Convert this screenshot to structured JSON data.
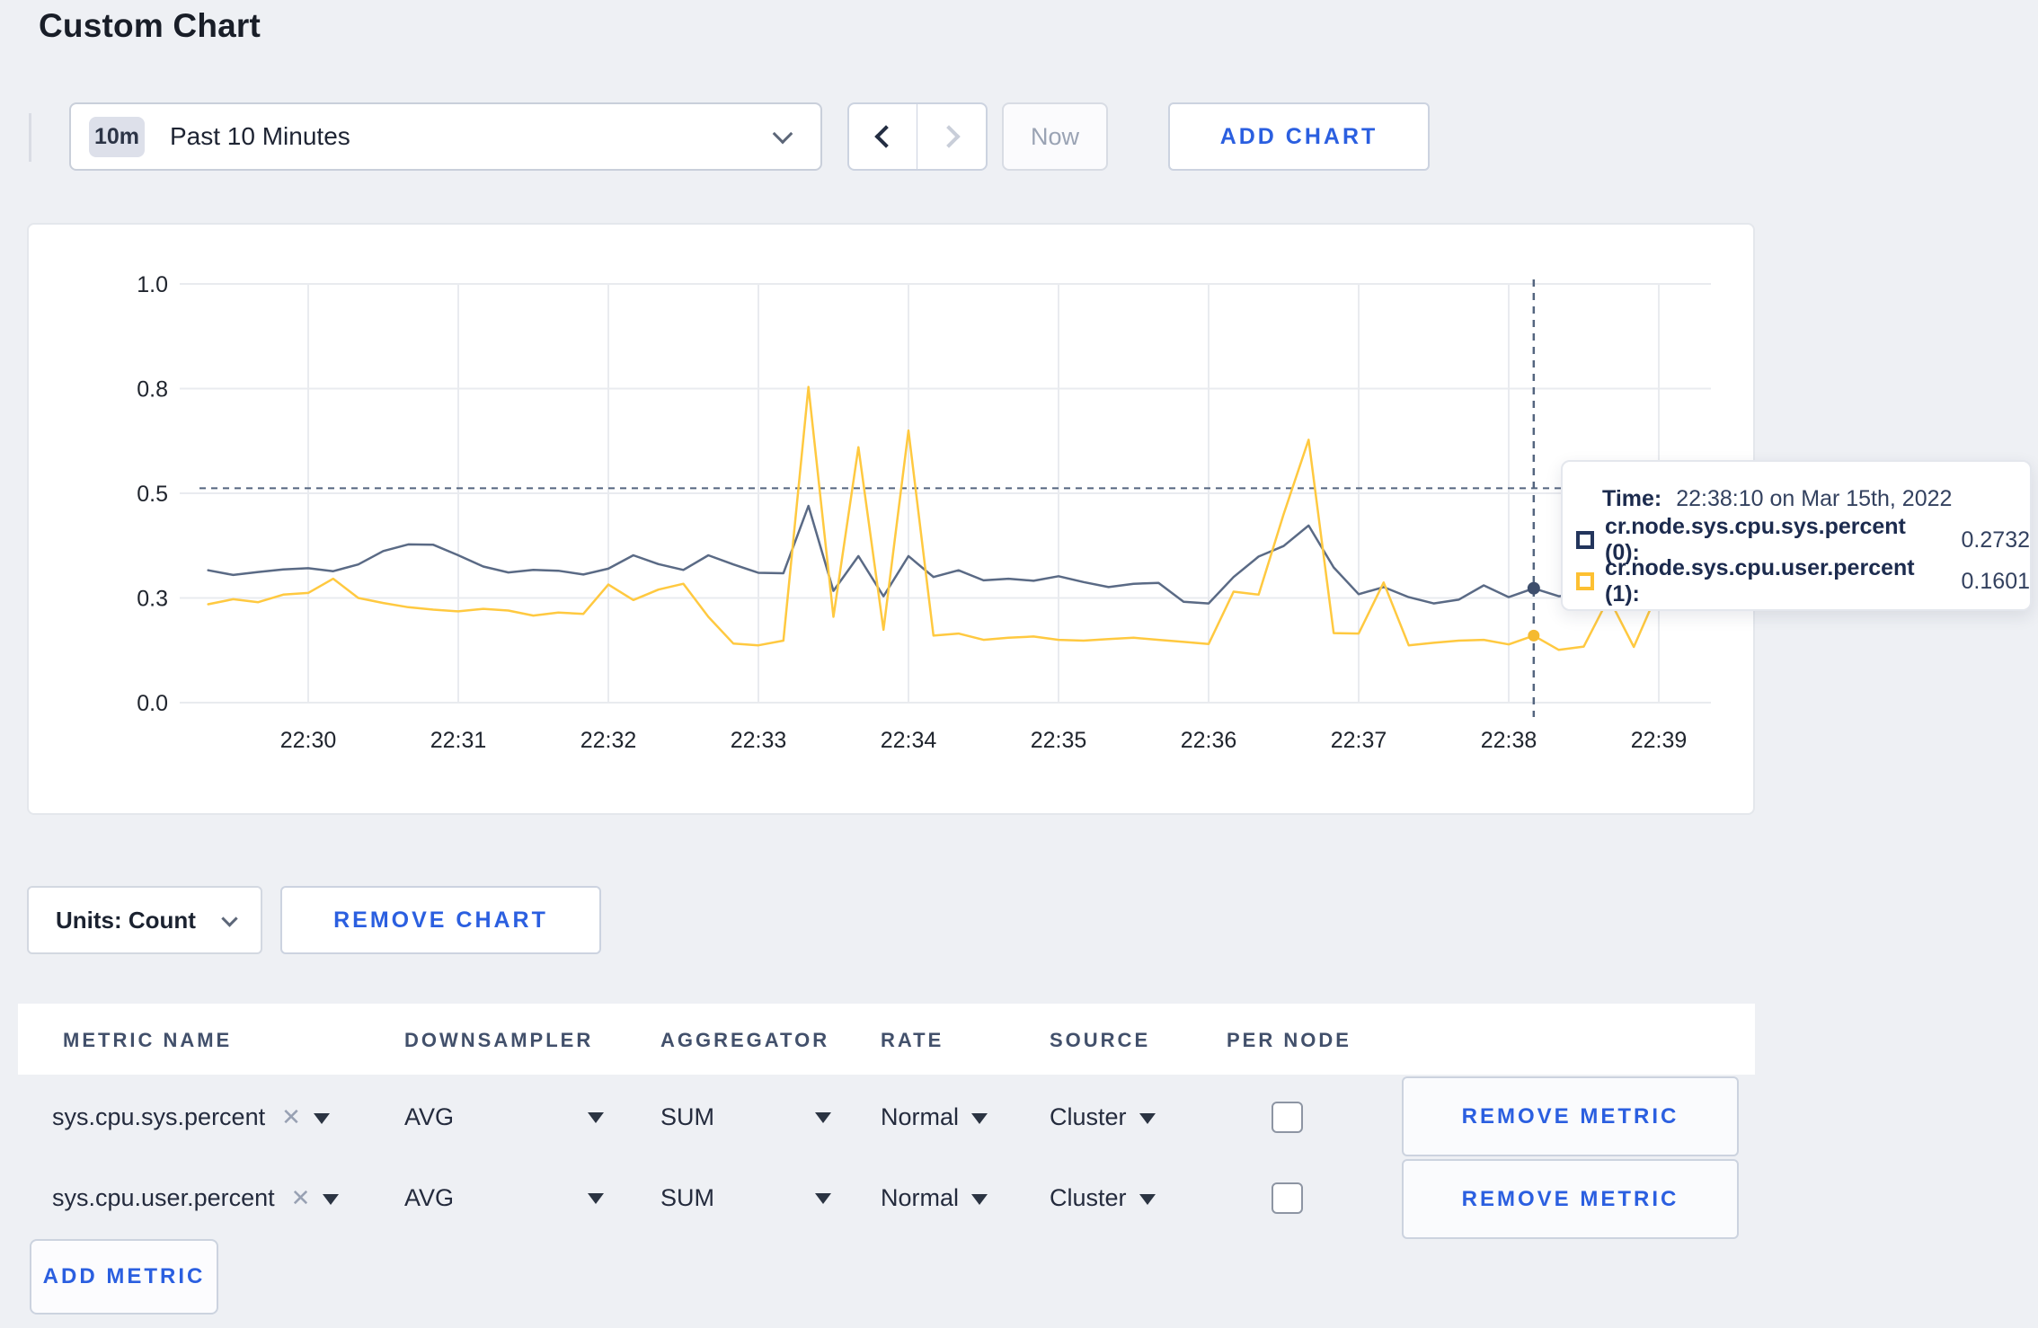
{
  "page": {
    "title": "Custom Chart"
  },
  "toolbar": {
    "time_window_badge": "10m",
    "time_window_label": "Past 10 Minutes",
    "now_label": "Now",
    "add_chart_label": "ADD CHART"
  },
  "chart_data": {
    "type": "line",
    "title": "",
    "xlabel": "",
    "ylabel": "",
    "ylim": [
      0,
      1
    ],
    "grid": true,
    "x_tick_labels": [
      "22:30",
      "22:31",
      "22:32",
      "22:33",
      "22:34",
      "22:35",
      "22:36",
      "22:37",
      "22:38",
      "22:39"
    ],
    "y_ticks": [
      {
        "value": 0,
        "label": "0.0"
      },
      {
        "value": 0.25,
        "label": "0.3"
      },
      {
        "value": 0.5,
        "label": "0.5"
      },
      {
        "value": 0.75,
        "label": "0.8"
      },
      {
        "value": 1.0,
        "label": "1.0"
      }
    ],
    "x_start_time": "22:29:20",
    "x_end_time": "22:39:00",
    "step_seconds": 10,
    "threshold_value": 0.512,
    "threshold_color": "#54657f",
    "grid_color": "#e9ebef",
    "tick_text_color": "#20252e",
    "crosshair": {
      "time": "22:38:10",
      "sys_value": 0.2732,
      "user_value": 0.1601,
      "line_color": "#54657f",
      "sys_dot_color": "#3d4e6c",
      "user_dot_color": "#f5ba30"
    },
    "series": [
      {
        "name": "cr.node.sys.cpu.sys.percent",
        "color": "#5a6a85",
        "values": [
          0.316,
          0.305,
          0.312,
          0.318,
          0.321,
          0.314,
          0.33,
          0.362,
          0.378,
          0.377,
          0.352,
          0.325,
          0.311,
          0.317,
          0.315,
          0.306,
          0.32,
          0.352,
          0.331,
          0.317,
          0.352,
          0.33,
          0.31,
          0.309,
          0.47,
          0.267,
          0.35,
          0.254,
          0.35,
          0.3,
          0.316,
          0.292,
          0.296,
          0.291,
          0.302,
          0.288,
          0.276,
          0.284,
          0.286,
          0.241,
          0.237,
          0.3,
          0.349,
          0.374,
          0.423,
          0.323,
          0.259,
          0.276,
          0.252,
          0.237,
          0.246,
          0.28,
          0.252,
          0.273,
          0.254,
          0.261,
          0.27,
          0.278,
          0.296
        ]
      },
      {
        "name": "cr.node.sys.cpu.user.percent",
        "color": "#ffc940",
        "values": [
          0.235,
          0.247,
          0.24,
          0.258,
          0.262,
          0.296,
          0.25,
          0.238,
          0.228,
          0.222,
          0.218,
          0.224,
          0.22,
          0.208,
          0.215,
          0.212,
          0.282,
          0.245,
          0.27,
          0.284,
          0.205,
          0.141,
          0.137,
          0.148,
          0.754,
          0.205,
          0.61,
          0.174,
          0.65,
          0.16,
          0.165,
          0.15,
          0.155,
          0.158,
          0.15,
          0.148,
          0.152,
          0.155,
          0.15,
          0.145,
          0.14,
          0.265,
          0.258,
          0.45,
          0.628,
          0.166,
          0.165,
          0.287,
          0.137,
          0.143,
          0.148,
          0.15,
          0.139,
          0.16,
          0.126,
          0.134,
          0.25,
          0.133,
          0.27
        ]
      }
    ]
  },
  "tooltip": {
    "time_label": "Time:",
    "time_value": "22:38:10 on Mar 15th, 2022",
    "rows": [
      {
        "series": "cr.node.sys.cpu.sys.percent (0):",
        "value": "0.2732",
        "swatch_color": "#23355c"
      },
      {
        "series": "cr.node.sys.cpu.user.percent (1):",
        "value": "0.1601",
        "swatch_color": "#fdc032"
      }
    ]
  },
  "units_bar": {
    "units_label": "Units: Count",
    "remove_chart_label": "REMOVE CHART"
  },
  "metrics_table": {
    "headers": [
      "METRIC NAME",
      "DOWNSAMPLER",
      "AGGREGATOR",
      "RATE",
      "SOURCE",
      "PER NODE"
    ],
    "rows": [
      {
        "metric": "sys.cpu.sys.percent",
        "close": "✕",
        "downsampler": "AVG",
        "aggregator": "SUM",
        "rate": "Normal",
        "source": "Cluster",
        "per_node_checked": false,
        "remove_label": "REMOVE METRIC"
      },
      {
        "metric": "sys.cpu.user.percent",
        "close": "✕",
        "downsampler": "AVG",
        "aggregator": "SUM",
        "rate": "Normal",
        "source": "Cluster",
        "per_node_checked": false,
        "remove_label": "REMOVE METRIC"
      }
    ],
    "add_metric_label": "ADD METRIC"
  },
  "colors": {
    "accent_blue": "#2b5fe0",
    "page_bg": "#eef0f4",
    "card_bg": "#ffffff"
  }
}
